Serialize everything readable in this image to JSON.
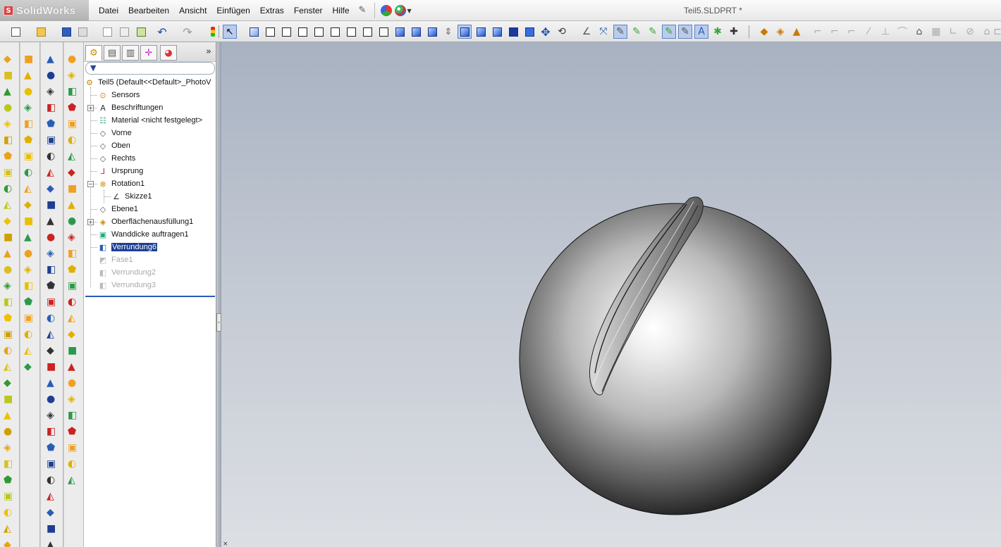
{
  "app": {
    "brand": "SolidWorks",
    "document_title": "Teil5.SLDPRT *"
  },
  "menu": {
    "items": [
      "Datei",
      "Bearbeiten",
      "Ansicht",
      "Einfügen",
      "Extras",
      "Fenster",
      "Hilfe"
    ]
  },
  "toolbar": {
    "icons": [
      "new-document-icon",
      "open-icon",
      "save-icon",
      "print-icon",
      "print-preview-icon",
      "options-icon",
      "rebuild-icon",
      "undo-icon",
      "redo-icon",
      "traffic-light-icon",
      "select-icon",
      "view-orientation-icons",
      "display-style-icons",
      "section-view-icon",
      "hide-show-icon",
      "appearance-icon",
      "scene-icon",
      "sketch-tools-icons"
    ]
  },
  "feature_tab_icons": [
    "featuremanager-tab-icon",
    "propertymanager-tab-icon",
    "configurationmanager-tab-icon",
    "dimxpert-tab-icon",
    "display-manager-tab-icon"
  ],
  "tree": {
    "root": "Teil5  (Default<<Default>_PhotoV",
    "items": [
      {
        "label": "Sensors",
        "icon": "sensors-icon",
        "state": "normal"
      },
      {
        "label": "Beschriftungen",
        "icon": "annotations-icon",
        "state": "normal",
        "expandable": true
      },
      {
        "label": "Material <nicht festgelegt>",
        "icon": "material-icon",
        "state": "normal"
      },
      {
        "label": "Vorne",
        "icon": "plane-icon",
        "state": "normal"
      },
      {
        "label": "Oben",
        "icon": "plane-icon",
        "state": "normal"
      },
      {
        "label": "Rechts",
        "icon": "plane-icon",
        "state": "normal"
      },
      {
        "label": "Ursprung",
        "icon": "origin-icon",
        "state": "normal"
      },
      {
        "label": "Rotation1",
        "icon": "revolve-icon",
        "state": "normal",
        "expandable": true,
        "expanded": true
      },
      {
        "label": "Skizze1",
        "icon": "sketch-icon",
        "state": "normal",
        "child": true
      },
      {
        "label": "Ebene1",
        "icon": "plane-icon",
        "state": "normal"
      },
      {
        "label": "Oberflächenausfüllung1",
        "icon": "fill-surface-icon",
        "state": "normal",
        "expandable": true
      },
      {
        "label": "Wanddicke auftragen1",
        "icon": "thicken-icon",
        "state": "normal"
      },
      {
        "label": "Verrundung6",
        "icon": "fillet-icon",
        "state": "selected"
      },
      {
        "label": "Fase1",
        "icon": "chamfer-icon",
        "state": "suppressed"
      },
      {
        "label": "Verrundung2",
        "icon": "fillet-icon",
        "state": "suppressed"
      },
      {
        "label": "Verrundung3",
        "icon": "fillet-icon",
        "state": "suppressed"
      }
    ]
  },
  "viewport": {
    "model": "sphere-with-slot",
    "background_top": "#a8b2c2",
    "background_bottom": "#dcdfe4"
  },
  "colors": {
    "selection": "#1c3f93",
    "suppressed_text": "#a9a9a9",
    "rollback_bar": "#2a5db5"
  }
}
